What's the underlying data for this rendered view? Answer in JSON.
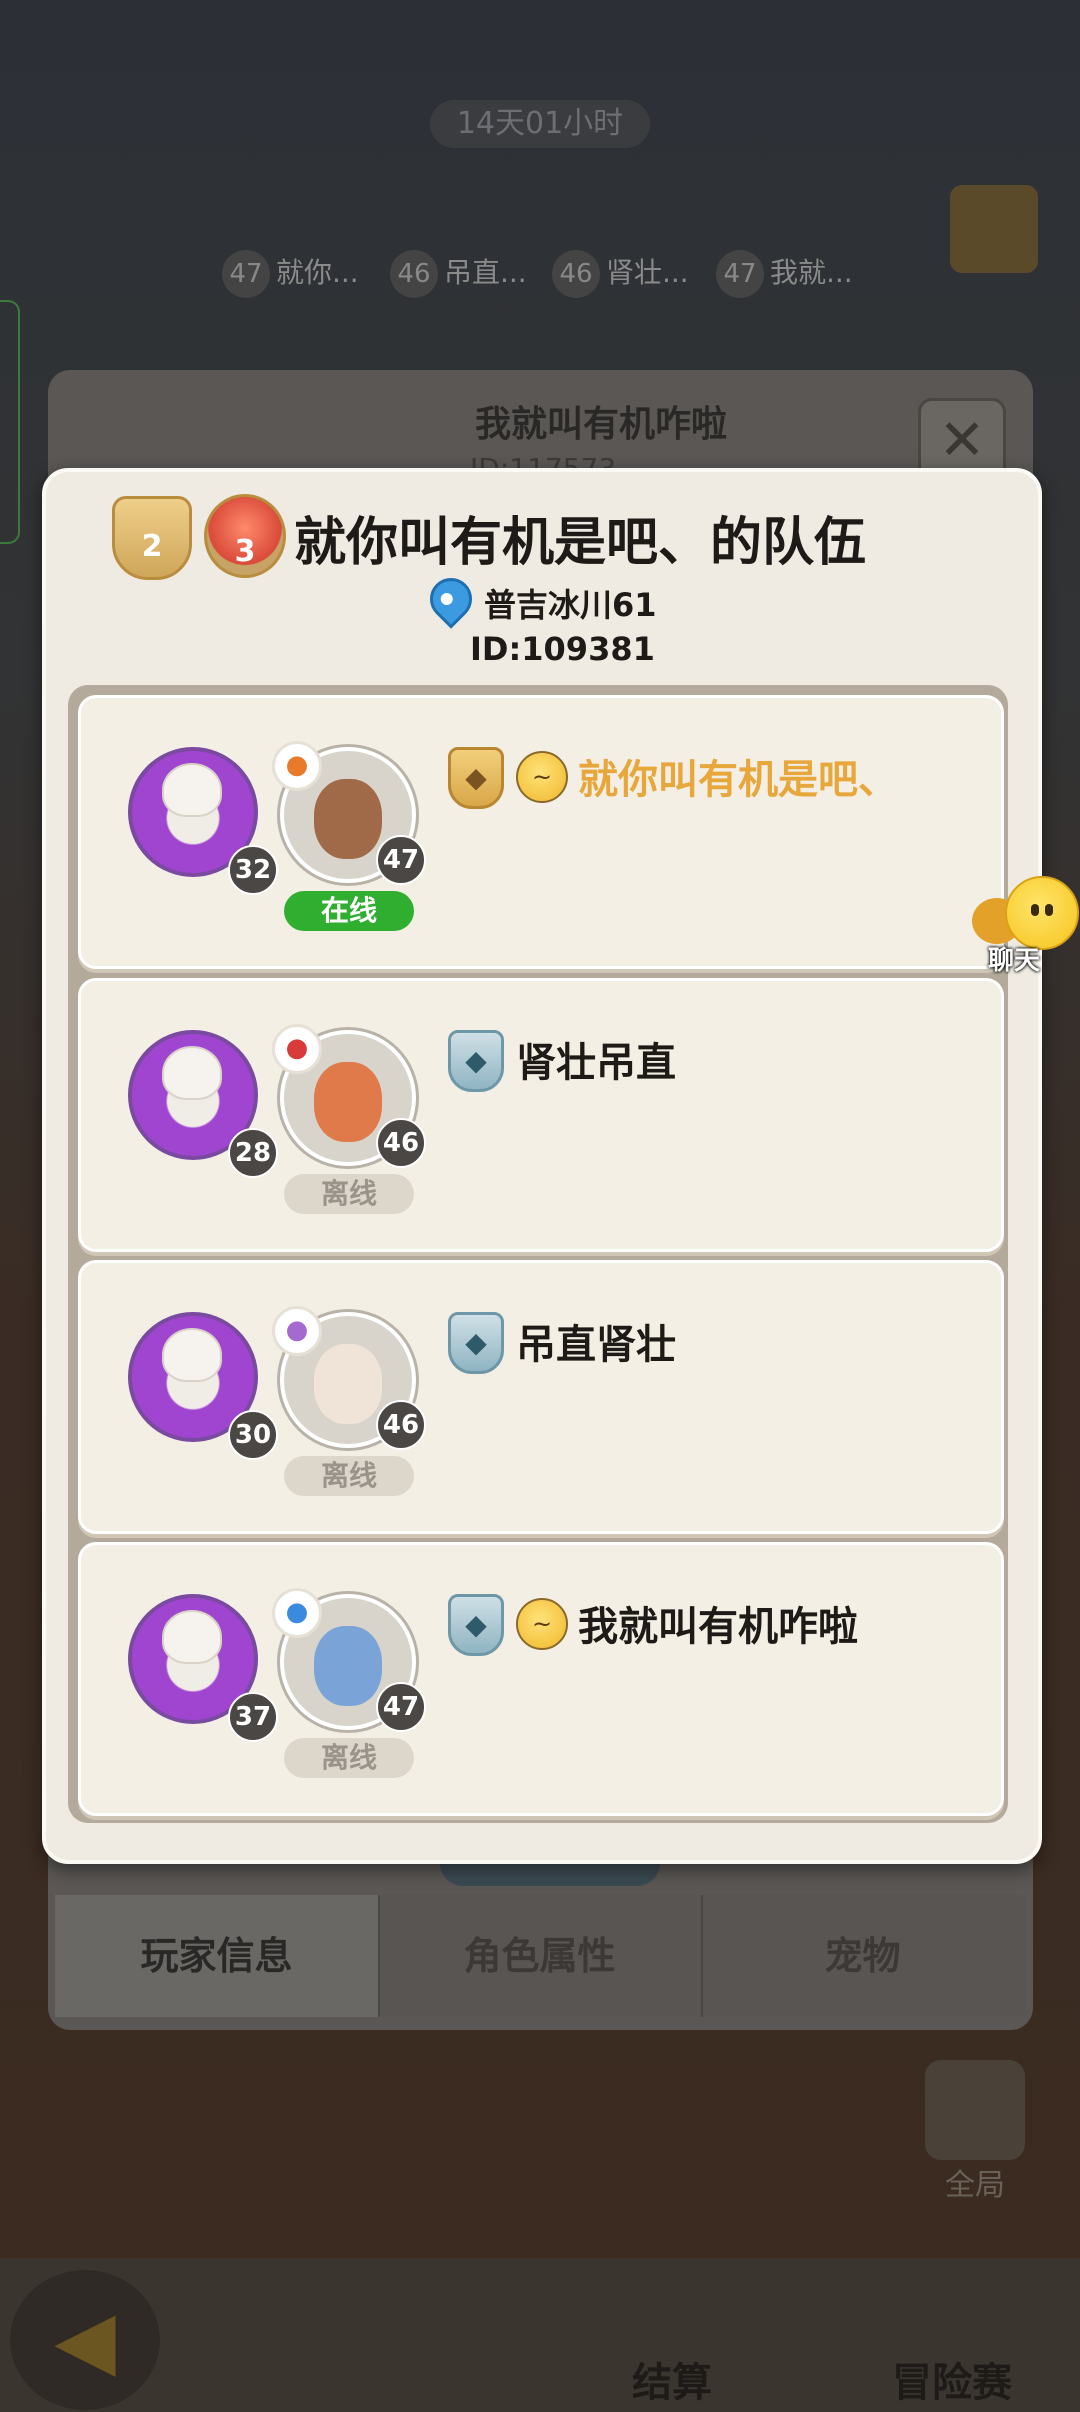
{
  "background": {
    "timer": "14天01小时",
    "team_strip": [
      {
        "level": "47",
        "name": "就你..."
      },
      {
        "level": "46",
        "name": "吊直..."
      },
      {
        "level": "46",
        "name": "肾壮..."
      },
      {
        "level": "47",
        "name": "我就..."
      }
    ],
    "profile_name": "我就叫有机咋啦",
    "profile_id": "ID:117573",
    "close_glyph": "✕",
    "tabs": [
      "玩家信息",
      "角色属性",
      "宠物"
    ],
    "global_label": "全局",
    "bottom_labels": {
      "settle": "结算",
      "adventure": "冒险赛"
    },
    "back_glyph": "◀"
  },
  "dialog": {
    "badge_left": "2",
    "badge_right": "3",
    "title": "就你叫有机是吧、的队伍",
    "location": "普吉冰川61",
    "id": "ID:109381",
    "members": [
      {
        "pet_level": "32",
        "hero_level": "47",
        "status": "在线",
        "online": true,
        "rank": "gold",
        "has_emoji": true,
        "name": "就你叫有机是吧、",
        "is_self": true,
        "class_color": "#e87a2a",
        "class_icon": "sword-icon",
        "face": "#a06a48"
      },
      {
        "pet_level": "28",
        "hero_level": "46",
        "status": "离线",
        "online": false,
        "rank": "silver",
        "has_emoji": false,
        "name": "肾壮吊直",
        "is_self": false,
        "class_color": "#d93a3a",
        "class_icon": "crossed-blades-icon",
        "face": "#e07a4a"
      },
      {
        "pet_level": "30",
        "hero_level": "46",
        "status": "离线",
        "online": false,
        "rank": "silver",
        "has_emoji": false,
        "name": "吊直肾壮",
        "is_self": false,
        "class_color": "#a46ad0",
        "class_icon": "orb-icon",
        "face": "#f0e4d8"
      },
      {
        "pet_level": "37",
        "hero_level": "47",
        "status": "离线",
        "online": false,
        "rank": "silver",
        "has_emoji": true,
        "name": "我就叫有机咋啦",
        "is_self": false,
        "class_color": "#3a8ae0",
        "class_icon": "wand-icon",
        "face": "#7aa4d8"
      }
    ]
  },
  "chat": {
    "label": "聊天"
  }
}
